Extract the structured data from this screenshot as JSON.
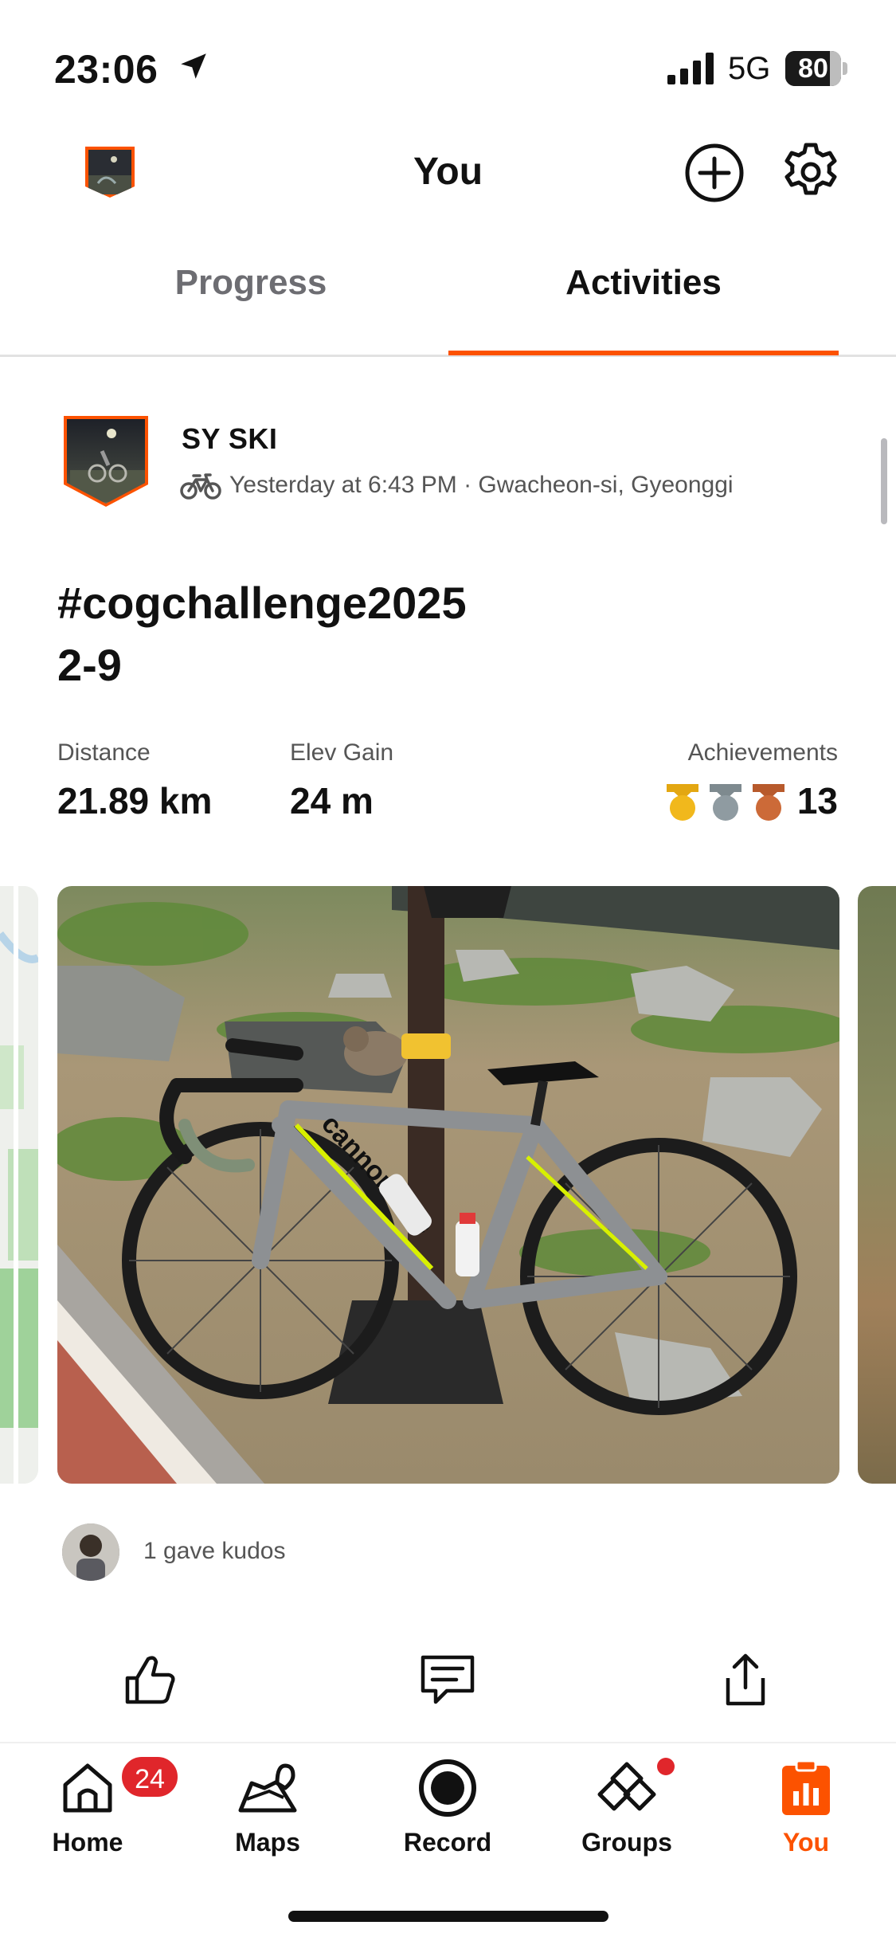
{
  "status_bar": {
    "time": "23:06",
    "network": "5G",
    "battery": "80",
    "battery_level": 0.8
  },
  "header": {
    "title": "You",
    "add_icon": "plus-circle-icon",
    "settings_icon": "gear-icon"
  },
  "tabs": [
    {
      "label": "Progress",
      "active": false
    },
    {
      "label": "Activities",
      "active": true
    }
  ],
  "accent_color": "#fc5200",
  "activity": {
    "athlete_name": "SY SKI",
    "sport_icon": "bike-icon",
    "meta": "Yesterday at 6:43 PM · Gwacheon-si, Gyeonggi",
    "title_line1": "#cogchallenge2025",
    "title_line2": "2-9",
    "stats": {
      "distance_label": "Distance",
      "distance_value": "21.89 km",
      "elev_label": "Elev Gain",
      "elev_value": "24 m",
      "achievements_label": "Achievements",
      "achievements_value": "13",
      "medals": [
        "gold-medal-icon",
        "silver-medal-icon",
        "bronze-medal-icon"
      ]
    },
    "kudos_text": "1 gave kudos",
    "actions": [
      "thumbs-up-icon",
      "comment-icon",
      "share-icon"
    ]
  },
  "bottom_nav": [
    {
      "label": "Home",
      "icon": "home-icon",
      "badge": "24",
      "active": false
    },
    {
      "label": "Maps",
      "icon": "maps-icon",
      "active": false
    },
    {
      "label": "Record",
      "icon": "record-icon",
      "active": false
    },
    {
      "label": "Groups",
      "icon": "groups-icon",
      "dot": true,
      "active": false
    },
    {
      "label": "You",
      "icon": "you-icon",
      "active": true
    }
  ],
  "badge_color": "#e0262b"
}
